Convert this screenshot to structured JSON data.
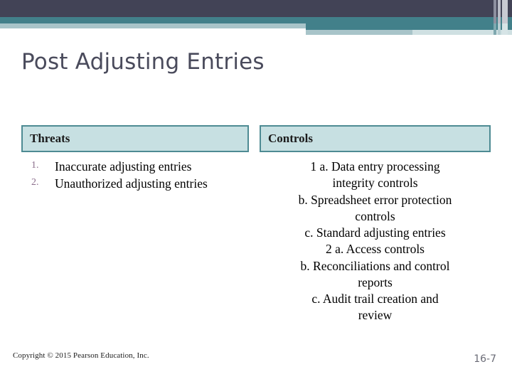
{
  "slide": {
    "title": "Post Adjusting Entries"
  },
  "theme": {
    "band_dark": "#424356",
    "band_teal": "#42808a",
    "band_light_teal": "#a8c4c9",
    "band_pale": "#cfe0e2",
    "title_color": "#4a4b5c",
    "table_header_fill": "#c7e0e2",
    "table_header_border": "#4e8b93",
    "list_number_color": "#8c6f8d",
    "page_number_color": "#6a6b76"
  },
  "table": {
    "columns": [
      {
        "header": "Threats",
        "items": [
          {
            "num": "1.",
            "text": "Inaccurate adjusting entries"
          },
          {
            "num": "2.",
            "text": "Unauthorized adjusting entries"
          }
        ]
      },
      {
        "header": "Controls",
        "items": [
          {
            "text": "1 a. Data entry processing"
          },
          {
            "text": "integrity controls"
          },
          {
            "text": "b. Spreadsheet error protection"
          },
          {
            "text": "controls"
          },
          {
            "text": "c. Standard adjusting entries"
          },
          {
            "text": "2 a. Access controls"
          },
          {
            "text": "b. Reconciliations and control"
          },
          {
            "text": "reports"
          },
          {
            "text": "c. Audit trail creation and"
          },
          {
            "text": "review"
          }
        ]
      }
    ]
  },
  "footer": {
    "copyright": "Copyright © 2015 Pearson Education, Inc.",
    "page_number": "16-7"
  }
}
